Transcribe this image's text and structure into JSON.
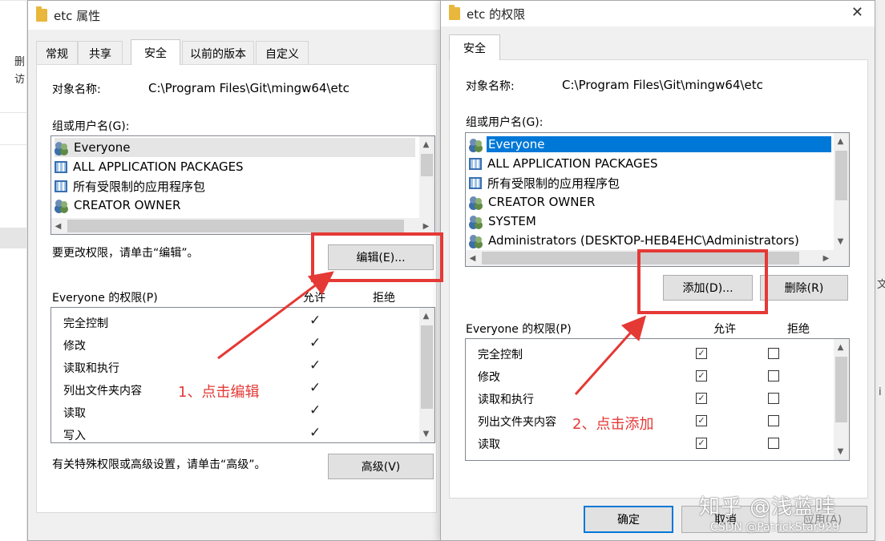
{
  "explorer_strip": {
    "item_a": "删",
    "item_b": "访"
  },
  "dialog_left": {
    "title": "etc 属性",
    "tabs": [
      {
        "label": "常规"
      },
      {
        "label": "共享"
      },
      {
        "label": "安全",
        "active": true
      },
      {
        "label": "以前的版本"
      },
      {
        "label": "自定义"
      }
    ],
    "object_name_label": "对象名称:",
    "object_name_value": "C:\\Program Files\\Git\\mingw64\\etc",
    "group_label": "组或用户名(G):",
    "groups": [
      {
        "name": "Everyone",
        "icon": "users-icon"
      },
      {
        "name": "ALL APPLICATION PACKAGES",
        "icon": "package-icon"
      },
      {
        "name": "所有受限制的应用程序包",
        "icon": "package-icon"
      },
      {
        "name": "CREATOR OWNER",
        "icon": "users-icon"
      }
    ],
    "edit_hint": "要更改权限，请单击“编辑”。",
    "edit_button": "编辑(E)...",
    "perm_title": "Everyone 的权限(P)",
    "allow_header": "允许",
    "deny_header": "拒绝",
    "permissions": [
      {
        "name": "完全控制",
        "allow": true,
        "deny": false
      },
      {
        "name": "修改",
        "allow": true,
        "deny": false
      },
      {
        "name": "读取和执行",
        "allow": true,
        "deny": false
      },
      {
        "name": "列出文件夹内容",
        "allow": true,
        "deny": false
      },
      {
        "name": "读取",
        "allow": true,
        "deny": false
      },
      {
        "name": "写入",
        "allow": true,
        "deny": false
      }
    ],
    "advanced_hint": "有关特殊权限或高级设置，请单击“高级”。",
    "advanced_button": "高级(V)"
  },
  "dialog_right": {
    "title": "etc 的权限",
    "close_glyph": "✕",
    "tab": "安全",
    "object_name_label": "对象名称:",
    "object_name_value": "C:\\Program Files\\Git\\mingw64\\etc",
    "group_label": "组或用户名(G):",
    "groups": [
      {
        "name": "Everyone",
        "icon": "users-icon",
        "selected": true
      },
      {
        "name": "ALL APPLICATION PACKAGES",
        "icon": "package-icon"
      },
      {
        "name": "所有受限制的应用程序包",
        "icon": "package-icon"
      },
      {
        "name": "CREATOR OWNER",
        "icon": "users-icon"
      },
      {
        "name": "SYSTEM",
        "icon": "users-icon"
      },
      {
        "name": "Administrators (DESKTOP-HEB4EHC\\Administrators)",
        "icon": "users-icon"
      }
    ],
    "add_button": "添加(D)...",
    "remove_button": "删除(R)",
    "perm_title": "Everyone 的权限(P)",
    "allow_header": "允许",
    "deny_header": "拒绝",
    "permissions": [
      {
        "name": "完全控制",
        "allow": true,
        "deny": false
      },
      {
        "name": "修改",
        "allow": true,
        "deny": false
      },
      {
        "name": "读取和执行",
        "allow": true,
        "deny": false
      },
      {
        "name": "列出文件夹内容",
        "allow": true,
        "deny": false
      },
      {
        "name": "读取",
        "allow": true,
        "deny": false
      }
    ],
    "ok_button": "确定",
    "cancel_button": "取消",
    "apply_button": "应用(A)"
  },
  "annotations": {
    "step1": "1、点击编辑",
    "step2": "2、点击添加",
    "color": "#e53935"
  },
  "watermark": {
    "main": "知乎 @浅蓝哇",
    "credit": "CSDN @PatrickStar929"
  },
  "edge_text": {
    "a": "文",
    "b": "i"
  }
}
